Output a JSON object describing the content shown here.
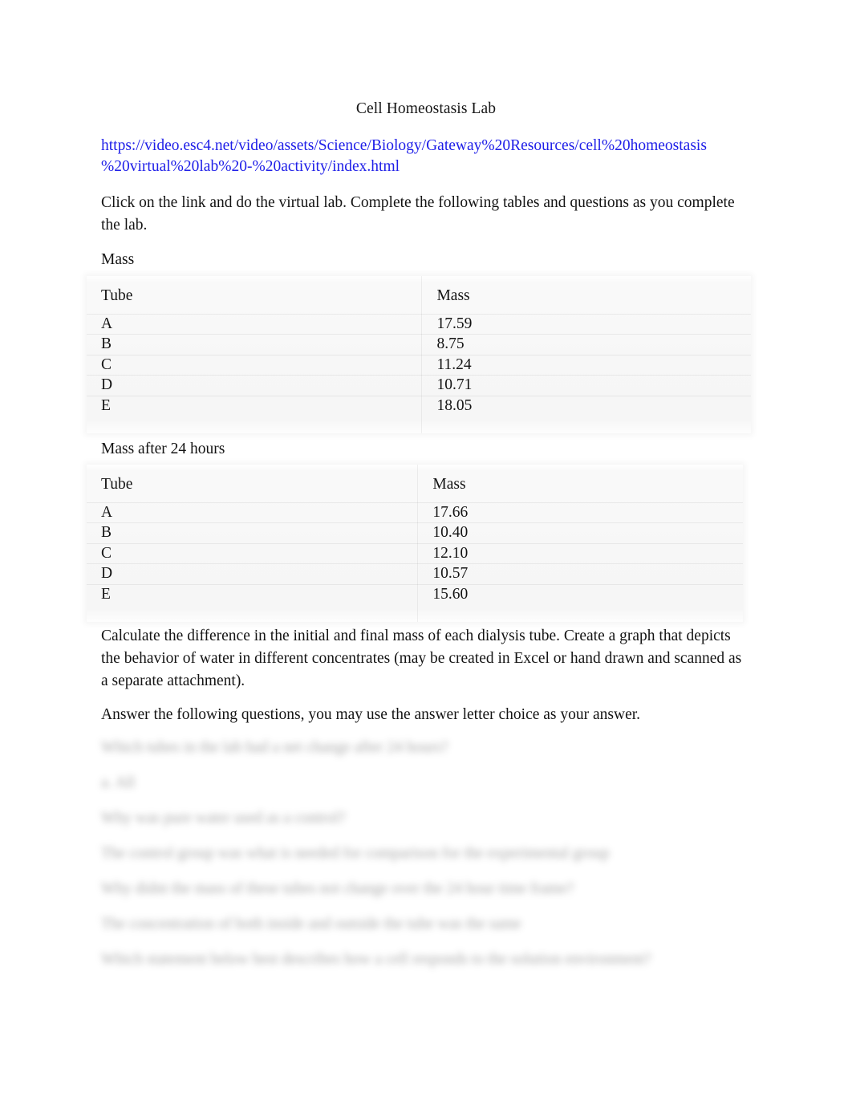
{
  "document": {
    "title": "Cell Homeostasis Lab",
    "url": "https://video.esc4.net/video/assets/Science/Biology/Gateway%20Resources/cell%20homeostasis%20virtual%20lab%20-%20activity/index.html",
    "url_line_1": "https://video.esc4.net/video/assets/Science/Biology/Gateway%20Resources/cell%20homeostasis",
    "url_line_2": "%20virtual%20lab%20-%20activity/index.html",
    "url_color": "#2020e8",
    "intro_paragraph": "Click on the link and do the virtual lab. Complete the following tables and questions as you complete the lab.",
    "calculate_paragraph": "Calculate the difference in the initial and final mass of each dialysis tube.  Create a graph that depicts the behavior of water in different concentrates (may be created in Excel or hand drawn and scanned as a separate attachment).",
    "answer_paragraph": "Answer the following questions, you may use the answer letter choice as your answer."
  },
  "table_mass": {
    "caption": "Mass",
    "headers": [
      "Tube",
      "Mass"
    ],
    "rows": [
      {
        "tube": "A",
        "mass": "17.59"
      },
      {
        "tube": "B",
        "mass": "8.75"
      },
      {
        "tube": "C",
        "mass": "11.24"
      },
      {
        "tube": "D",
        "mass": "10.71"
      },
      {
        "tube": "E",
        "mass": "18.05"
      }
    ]
  },
  "table_mass_24h": {
    "caption": "Mass after 24 hours",
    "headers": [
      "Tube",
      "Mass"
    ],
    "rows": [
      {
        "tube": "A",
        "mass": "17.66"
      },
      {
        "tube": "B",
        "mass": "10.40"
      },
      {
        "tube": "C",
        "mass": "12.10"
      },
      {
        "tube": "D",
        "mass": "10.57"
      },
      {
        "tube": "E",
        "mass": "15.60"
      }
    ]
  },
  "redacted_questions": {
    "note": "blurred-illegible",
    "lines": [
      "Which tubes in the lab had a net change after 24 hours?",
      "a. All",
      "Why was pure water used as a control?",
      "The control group was what is needed for comparison for the experimental group",
      "Why didnt the mass of these tubes not change over the 24 hour time frame?",
      "The concentration of both inside and outside the tube was the same",
      "Which statement below best describes how a cell responds to the solution environment?"
    ]
  }
}
